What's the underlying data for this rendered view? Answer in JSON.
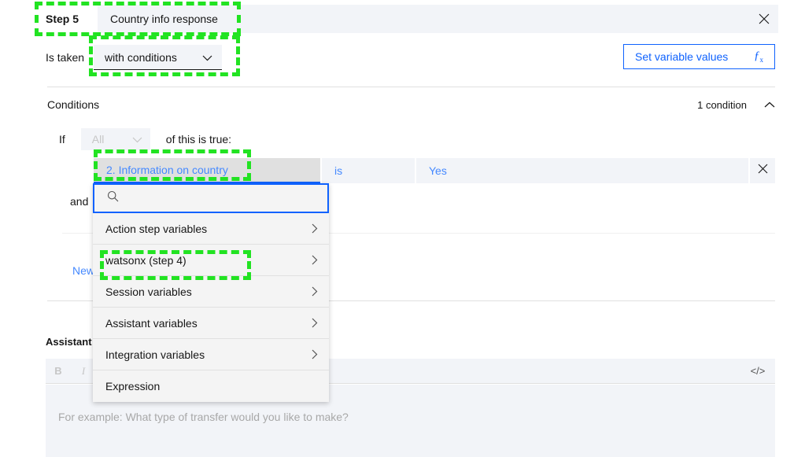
{
  "step": {
    "label": "Step 5",
    "name_value": "Country info response",
    "close_icon": "close-icon"
  },
  "is_taken": {
    "label": "Is taken",
    "selected": "with conditions",
    "chevron_icon": "chevron-down-icon"
  },
  "set_variable_values": {
    "label": "Set variable values",
    "icon": "fx-icon"
  },
  "conditions": {
    "title": "Conditions",
    "count_label": "1 condition",
    "collapse_icon": "chevron-up-icon",
    "if_label": "If",
    "match_selected": "All",
    "match_chevron_icon": "chevron-down-icon",
    "if_suffix": "of this is true:",
    "and_label": "and",
    "new_link": "New",
    "rows": [
      {
        "variable": "2. Information on country",
        "operator": "is",
        "value": "Yes",
        "delete_icon": "close-icon"
      }
    ]
  },
  "dropdown": {
    "search_placeholder": "",
    "search_value": "",
    "search_icon": "search-icon",
    "items": [
      {
        "label": "Action step variables",
        "chevron": "chevron-right-icon",
        "has_chevron": true
      },
      {
        "label": "watsonx (step 4)",
        "chevron": "chevron-right-icon",
        "has_chevron": true
      },
      {
        "label": "Session variables",
        "chevron": "chevron-right-icon",
        "has_chevron": true
      },
      {
        "label": "Assistant variables",
        "chevron": "chevron-right-icon",
        "has_chevron": true
      },
      {
        "label": "Integration variables",
        "chevron": "chevron-right-icon",
        "has_chevron": true
      },
      {
        "label": "Expression",
        "chevron": "",
        "has_chevron": false
      }
    ]
  },
  "assistant": {
    "label": "Assistant",
    "toolbar": {
      "bold": "B",
      "italic": "I",
      "code": "</>"
    },
    "editor_placeholder": "For example: What type of transfer would you like to make?"
  },
  "colors": {
    "accent_blue": "#0f62fe",
    "link_blue": "#4589ff",
    "field_gray": "#f2f4f8",
    "selected_gray": "#e0e0e0",
    "highlight_green": "#22e322"
  }
}
